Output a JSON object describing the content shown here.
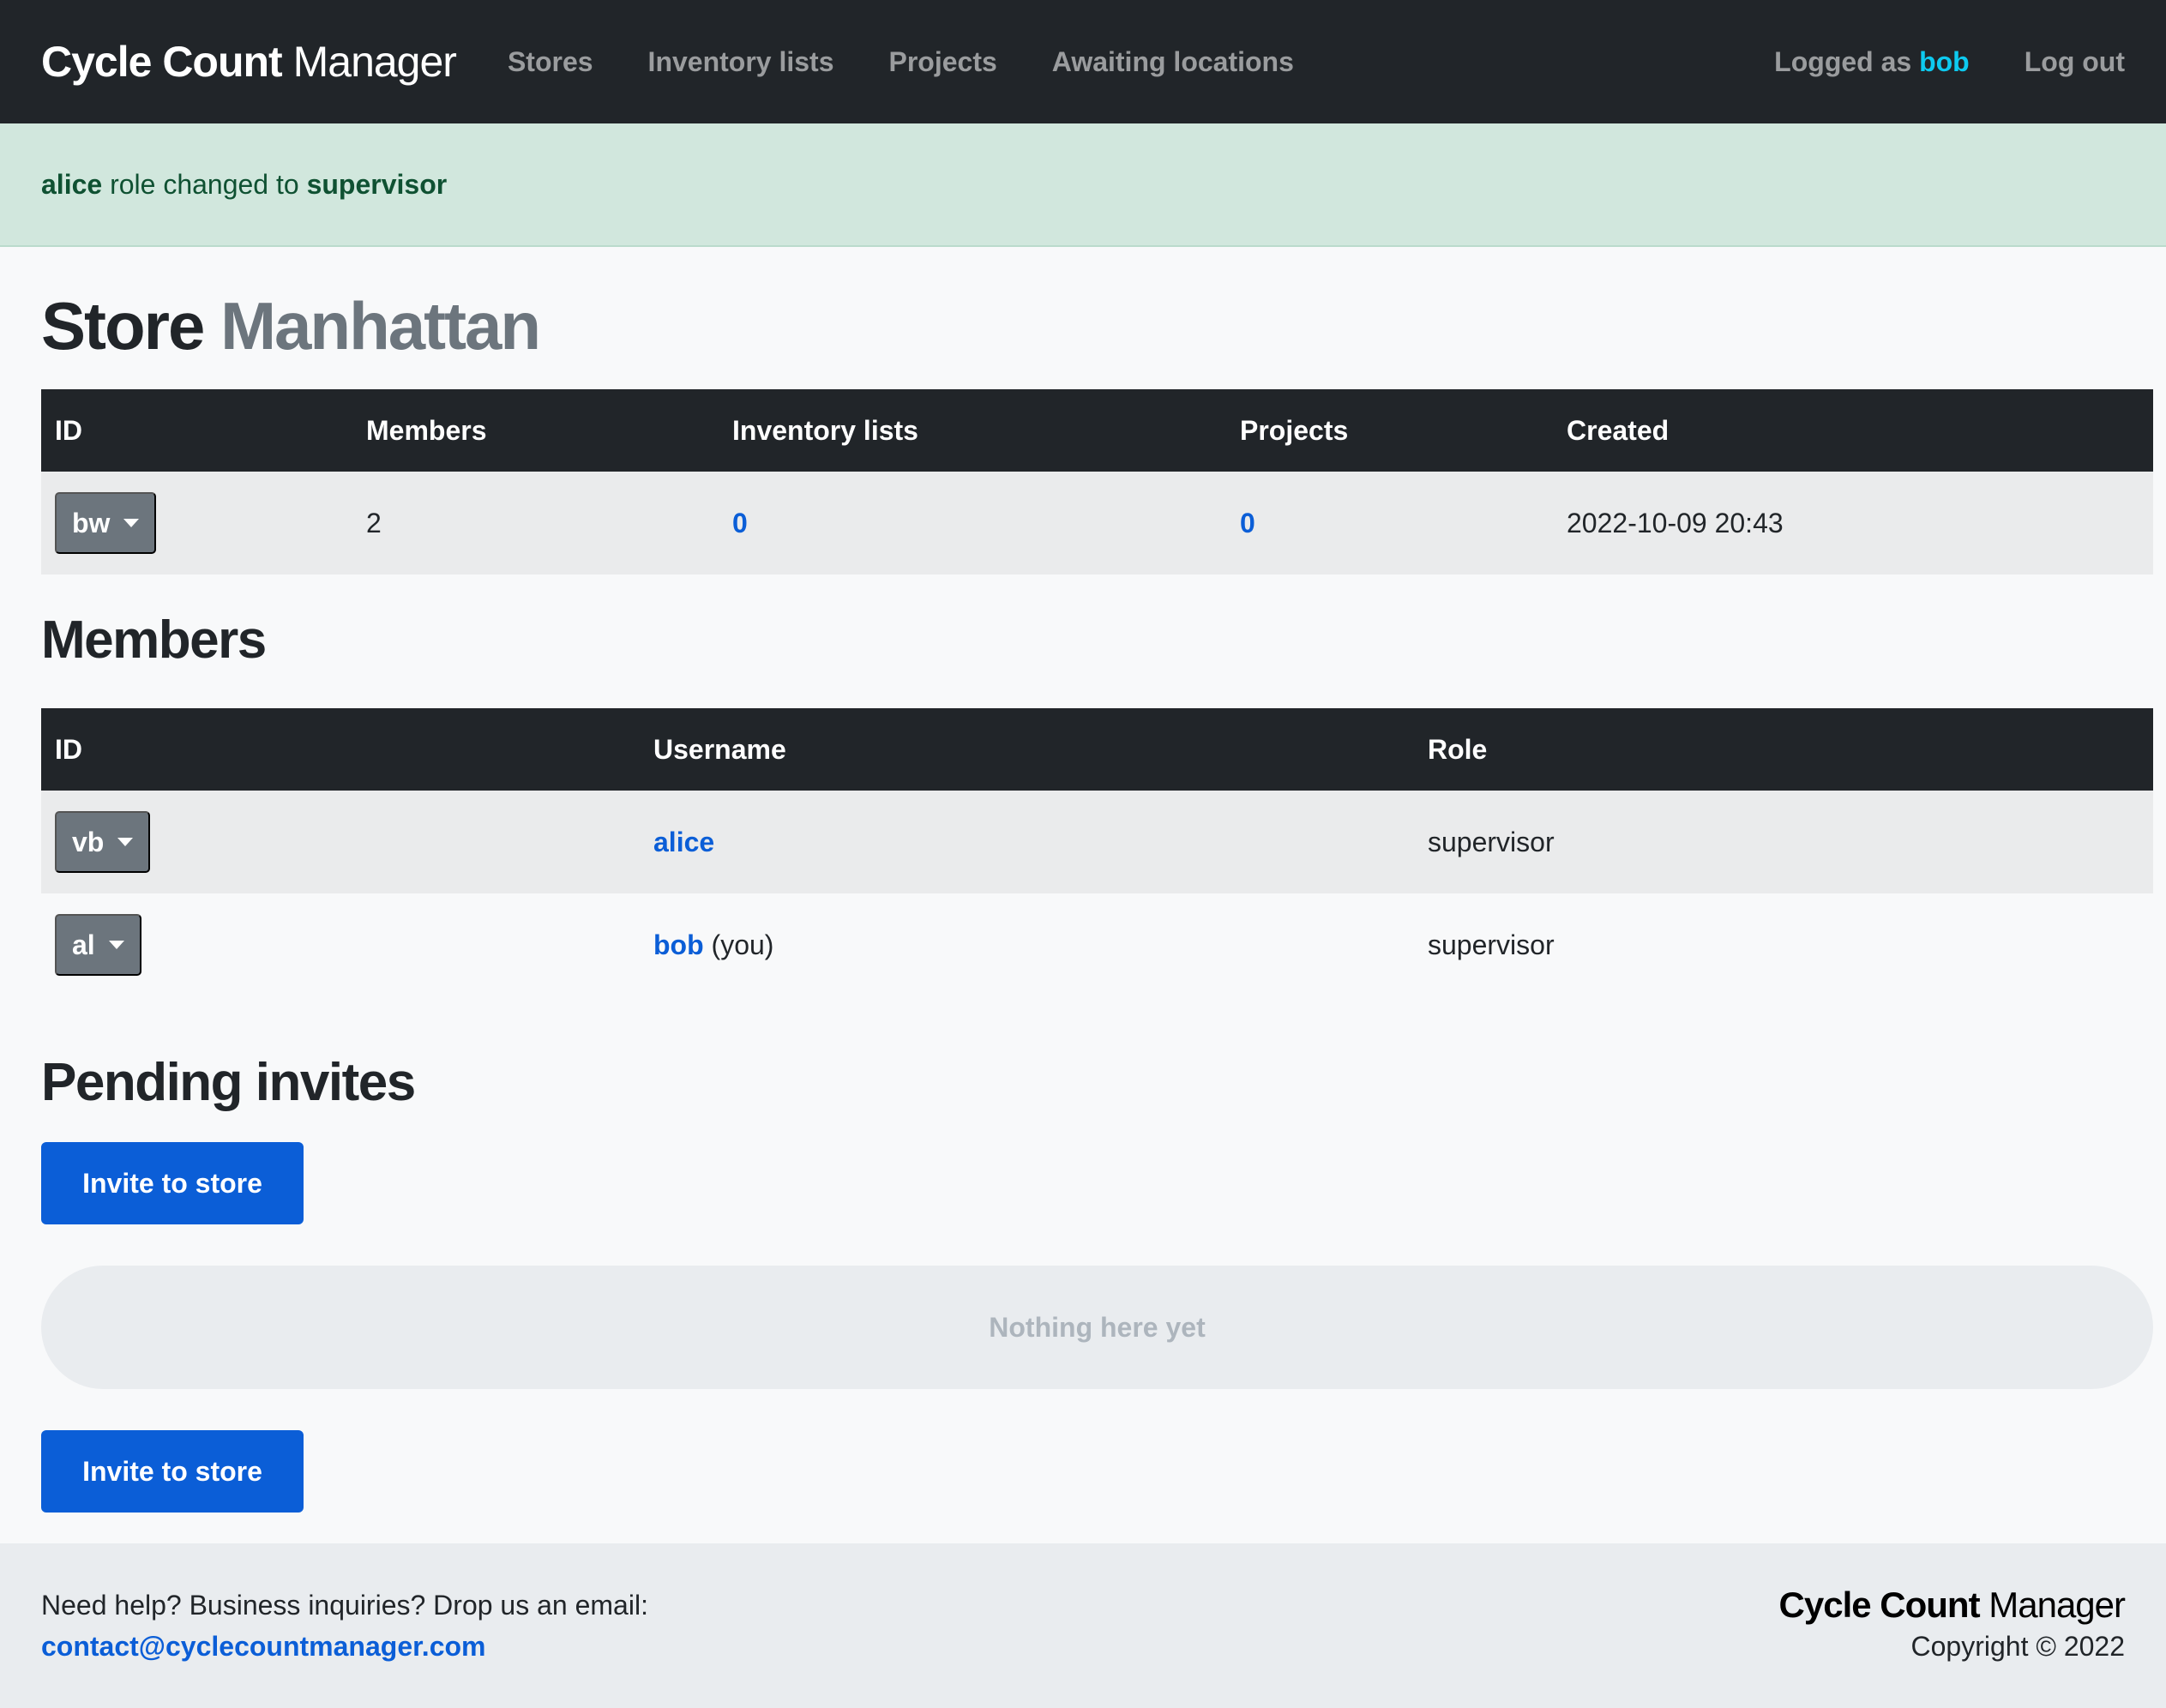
{
  "nav": {
    "brand_bold": "Cycle Count",
    "brand_light": "Manager",
    "links": [
      "Stores",
      "Inventory lists",
      "Projects",
      "Awaiting locations"
    ],
    "logged_prefix": "Logged as",
    "logged_user": "bob",
    "logout": "Log out"
  },
  "alert": {
    "user": "alice",
    "middle": "role changed to",
    "role": "supervisor"
  },
  "store": {
    "title_prefix": "Store",
    "title_name": "Manhattan",
    "columns": [
      "ID",
      "Members",
      "Inventory lists",
      "Projects",
      "Created"
    ],
    "row": {
      "id": "bw",
      "members": "2",
      "inventory_lists": "0",
      "projects": "0",
      "created": "2022-10-09 20:43"
    }
  },
  "members": {
    "title": "Members",
    "columns": [
      "ID",
      "Username",
      "Role"
    ],
    "rows": [
      {
        "id": "vb",
        "username": "alice",
        "suffix": "",
        "role": "supervisor"
      },
      {
        "id": "al",
        "username": "bob",
        "suffix": "(you)",
        "role": "supervisor"
      }
    ]
  },
  "invites": {
    "title": "Pending invites",
    "invite_button": "Invite to store",
    "empty": "Nothing here yet"
  },
  "footer": {
    "help": "Need help? Business inquiries? Drop us an email:",
    "email": "contact@cyclecountmanager.com",
    "brand_bold": "Cycle Count",
    "brand_light": "Manager",
    "copyright": "Copyright © 2022"
  },
  "colors": {
    "navbar": "#212529",
    "accent": "#0b5ed7",
    "alert_bg": "#d1e7dd",
    "alert_text": "#0f5132",
    "logged_user": "#0dcaf0",
    "id_button": "#6c757d"
  }
}
